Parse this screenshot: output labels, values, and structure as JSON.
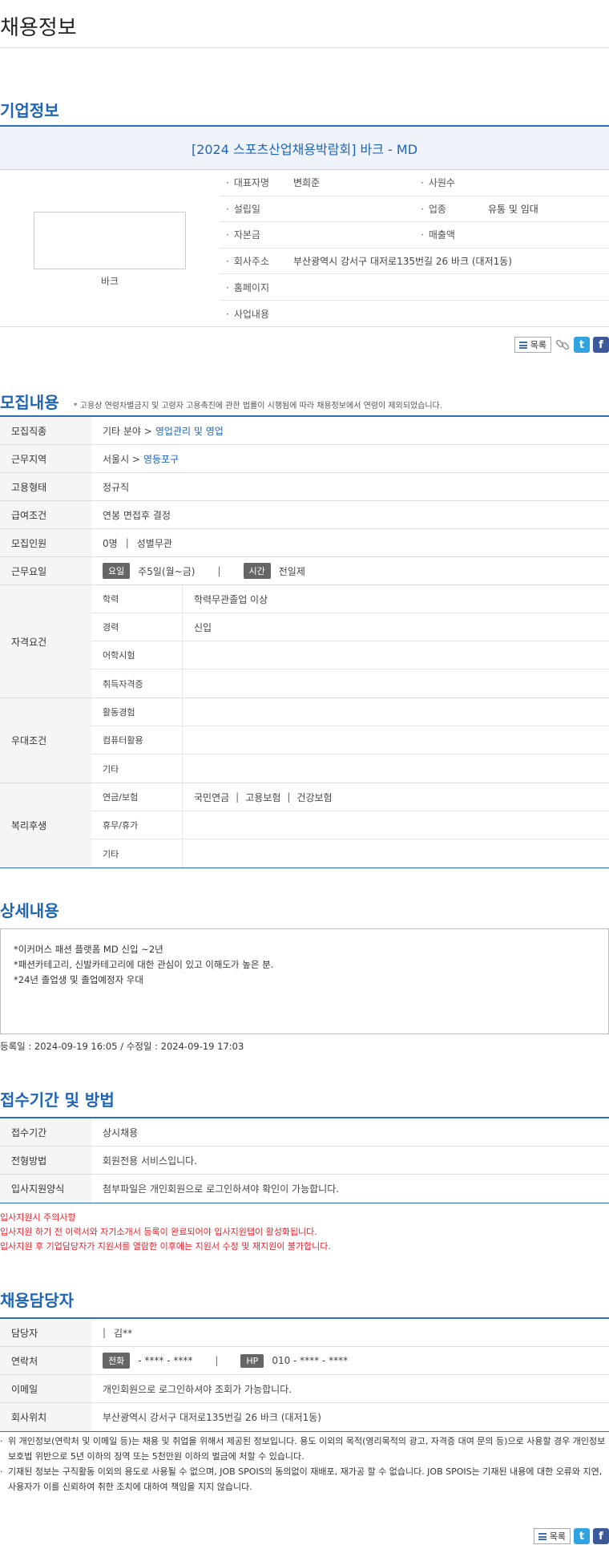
{
  "page": {
    "title": "채용정보"
  },
  "company": {
    "section_title": "기업정보",
    "name": "[2024 스포츠산업채용박람회] 바크 - MD",
    "logo_caption": "바크",
    "rep_label": "대표자명",
    "rep_value": "변희준",
    "employees_label": "사원수",
    "employees_value": "",
    "founded_label": "설립일",
    "founded_value": "",
    "industry_label": "업종",
    "industry_value": "유통 및 임대",
    "capital_label": "자본금",
    "capital_value": "",
    "sales_label": "매출액",
    "sales_value": "",
    "address_label": "회사주소",
    "address_value": "부산광역시 강서구 대저로135번길 26 바크 (대저1동)",
    "homepage_label": "홈페이지",
    "homepage_value": "",
    "business_label": "사업내용",
    "business_value": ""
  },
  "share": {
    "list_label": "목록",
    "link_icon": "link-icon",
    "twitter_icon": "t",
    "facebook_icon": "f"
  },
  "recruit": {
    "section_title": "모집내용",
    "note": "* 고용상 연령차별금지 및 고령자 고용촉진에 관한 법률이 시행됨에 따라 채용정보에서 연령이 제외되었습니다.",
    "job_label": "모집직종",
    "job_prefix": "기타 분야 >",
    "job_link": "영업관리 및 영업",
    "area_label": "근무지역",
    "area_prefix": "서울시 >",
    "area_link": "영등포구",
    "type_label": "고용형태",
    "type_value": "정규직",
    "salary_label": "급여조건",
    "salary_value": "연봉 면접후 결정",
    "count_label": "모집인원",
    "count_value": "0명",
    "gender_value": "성별무관",
    "sep": "|",
    "days_label": "근무요일",
    "days_badge": "요일",
    "days_value": "주5일(월~금)",
    "time_badge": "시간",
    "time_value": "전일제",
    "qual_label": "자격요건",
    "edu_label": "학력",
    "edu_value": "학력무관졸업 이상",
    "career_label": "경력",
    "career_value": "신입",
    "lang_label": "어학시험",
    "lang_value": "",
    "cert_label": "취득자격증",
    "cert_value": "",
    "pref_label": "우대조건",
    "act_label": "활동경험",
    "act_value": "",
    "pc_label": "컴퓨터활용",
    "pc_value": "",
    "etc_label": "기타",
    "etc_value": "",
    "welfare_label": "복리후생",
    "insurance_label": "연금/보험",
    "ins1": "국민연금",
    "ins2": "고용보험",
    "ins3": "건강보험",
    "leave_label": "휴무/휴가",
    "leave_value": "",
    "wetc_label": "기타",
    "wetc_value": ""
  },
  "detail": {
    "section_title": "상세내용",
    "lines": [
      "*이커머스 패션 플랫폼 MD 신입 ~2년",
      "*패션카테고리, 신발카테고리에 대한 관심이 있고 이해도가 높은 분.",
      "*24년 졸업생 및 졸업예정자 우대"
    ],
    "dates": "등록일 : 2024-09-19 16:05 / 수정일 : 2024-09-19 17:03"
  },
  "apply": {
    "section_title": "접수기간 및 방법",
    "period_label": "접수기간",
    "period_value": "상시채용",
    "method_label": "전형방법",
    "method_value": "회원전용 서비스입니다.",
    "form_label": "입사지원양식",
    "form_value": "첨부파일은 개인회원으로 로그인하셔야 확인이 가능합니다.",
    "warn1": "입사지원시 주의사항",
    "warn2": "입사지원 하기 전 이력서와 자기소개서 등록이 완료되어야 입사지원탭이 활성화됩니다.",
    "warn3": "입사지원 후 기업담당자가 지원서를 열람한 이후에는 지원서 수정 및 재지원이 불가합니다."
  },
  "contact": {
    "section_title": "채용담당자",
    "person_label": "담당자",
    "person_value": "김**",
    "sep": "|",
    "phone_label": "연락처",
    "tel_badge": "전화",
    "tel_value": "- **** - ****",
    "hp_badge": "HP",
    "hp_value": "010 - **** - ****",
    "email_label": "이메일",
    "email_value": "개인회원으로 로그인하셔야 조회가 가능합니다.",
    "loc_label": "회사위치",
    "loc_value": "부산광역시 강서구 대저로135번길 26 바크 (대저1동)"
  },
  "notes": [
    "위 개인정보(연락처 및 이메일 등)는 채용 및 취업을 위해서 제공된 정보입니다. 용도 이외의 목적(영리목적의 광고, 자격증 대여 문의 등)으로 사용할 경우 개인정보보호법 위반으로 5년 이하의 징역 또는 5천만원 이하의 벌금에 처할 수 있습니다.",
    "기재된 정보는 구직활동 이외의 용도로 사용될 수 없으며, JOB SPOIS의 동의없이 재배포, 재가공 할 수 없습니다. JOB SPOIS는 기재된 내용에 대한 오류와 지연, 사용자가 이를 신뢰하여 취한 조치에 대하여 책임을 지지 않습니다."
  ]
}
